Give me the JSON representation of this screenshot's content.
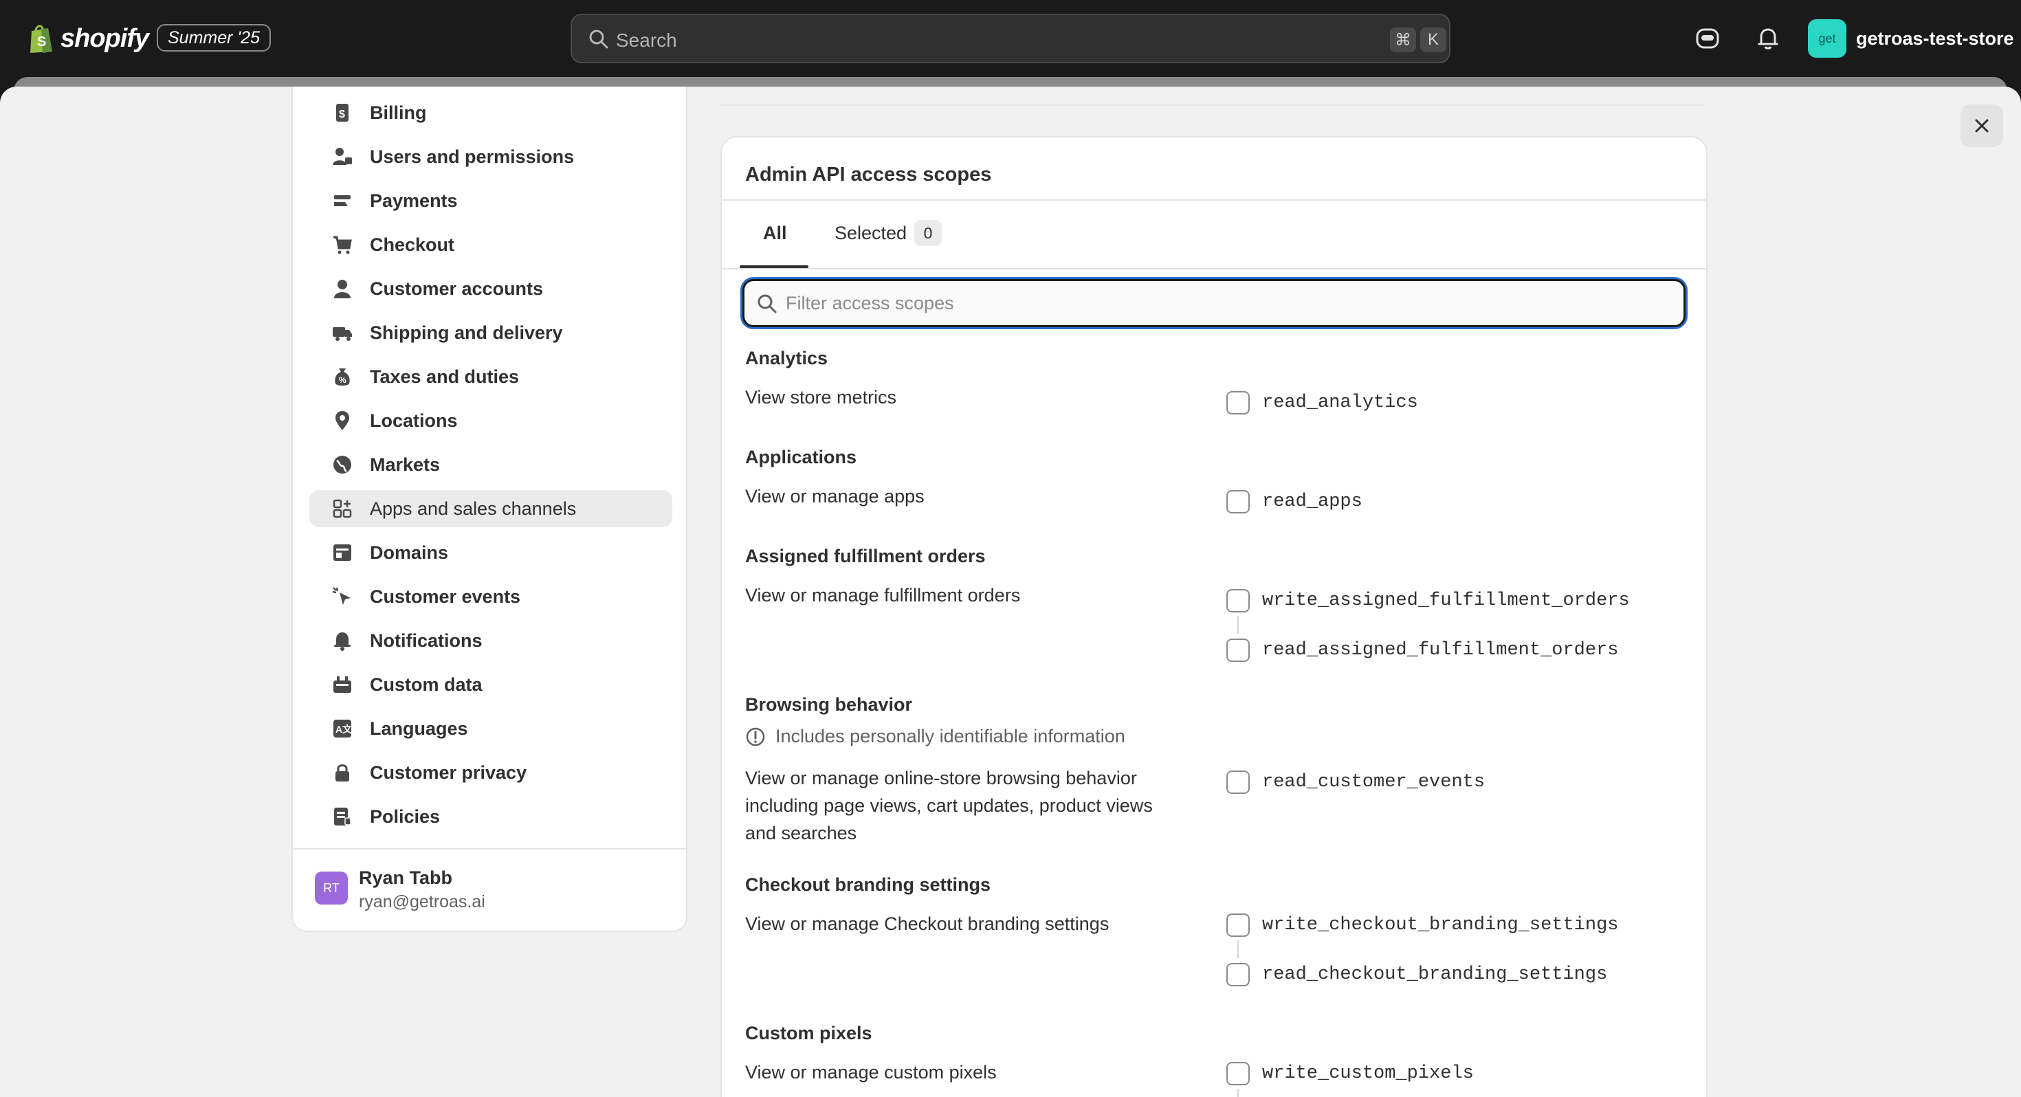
{
  "topbar": {
    "brand": "shopify",
    "edition": "Summer '25",
    "search_placeholder": "Search",
    "shortcut_keys": [
      "⌘",
      "K"
    ],
    "store_avatar": "get",
    "store_name": "getroas-test-store"
  },
  "sidebar": {
    "items": [
      {
        "label": "Billing",
        "icon": "billing-icon"
      },
      {
        "label": "Users and permissions",
        "icon": "users-icon"
      },
      {
        "label": "Payments",
        "icon": "payments-icon"
      },
      {
        "label": "Checkout",
        "icon": "cart-icon"
      },
      {
        "label": "Customer accounts",
        "icon": "person-icon"
      },
      {
        "label": "Shipping and delivery",
        "icon": "truck-icon"
      },
      {
        "label": "Taxes and duties",
        "icon": "tax-icon"
      },
      {
        "label": "Locations",
        "icon": "location-icon"
      },
      {
        "label": "Markets",
        "icon": "globe-icon"
      },
      {
        "label": "Apps and sales channels",
        "icon": "apps-icon",
        "active": true
      },
      {
        "label": "Domains",
        "icon": "domain-icon"
      },
      {
        "label": "Customer events",
        "icon": "cursor-icon"
      },
      {
        "label": "Notifications",
        "icon": "bell-icon"
      },
      {
        "label": "Custom data",
        "icon": "data-icon"
      },
      {
        "label": "Languages",
        "icon": "language-icon"
      },
      {
        "label": "Customer privacy",
        "icon": "lock-icon"
      },
      {
        "label": "Policies",
        "icon": "policy-icon"
      }
    ],
    "user": {
      "initials": "RT",
      "name": "Ryan Tabb",
      "email": "ryan@getroas.ai"
    }
  },
  "card": {
    "title": "Admin API access scopes",
    "tabs": {
      "all": "All",
      "selected": "Selected",
      "selected_count": "0"
    },
    "filter_placeholder": "Filter access scopes",
    "groups": [
      {
        "title": "Analytics",
        "desc": "View store metrics",
        "scopes": [
          "read_analytics"
        ]
      },
      {
        "title": "Applications",
        "desc": "View or manage apps",
        "scopes": [
          "read_apps"
        ]
      },
      {
        "title": "Assigned fulfillment orders",
        "desc": "View or manage fulfillment orders",
        "scopes": [
          "write_assigned_fulfillment_orders",
          "read_assigned_fulfillment_orders"
        ]
      },
      {
        "title": "Browsing behavior",
        "pii": "Includes personally identifiable information",
        "desc": "View or manage online-store browsing behavior including page views, cart updates, product views and searches",
        "scopes": [
          "read_customer_events"
        ]
      },
      {
        "title": "Checkout branding settings",
        "desc": "View or manage Checkout branding settings",
        "scopes": [
          "write_checkout_branding_settings",
          "read_checkout_branding_settings"
        ]
      },
      {
        "title": "Custom pixels",
        "desc": "View or manage custom pixels",
        "scopes": [
          "write_custom_pixels"
        ]
      }
    ]
  },
  "colors": {
    "topbar": "#1a1a1a",
    "surface": "#f1f1f1",
    "focus_ring": "#2c6ecb",
    "store_avatar": "#2ad7c4",
    "user_avatar": "#9c6ade"
  }
}
